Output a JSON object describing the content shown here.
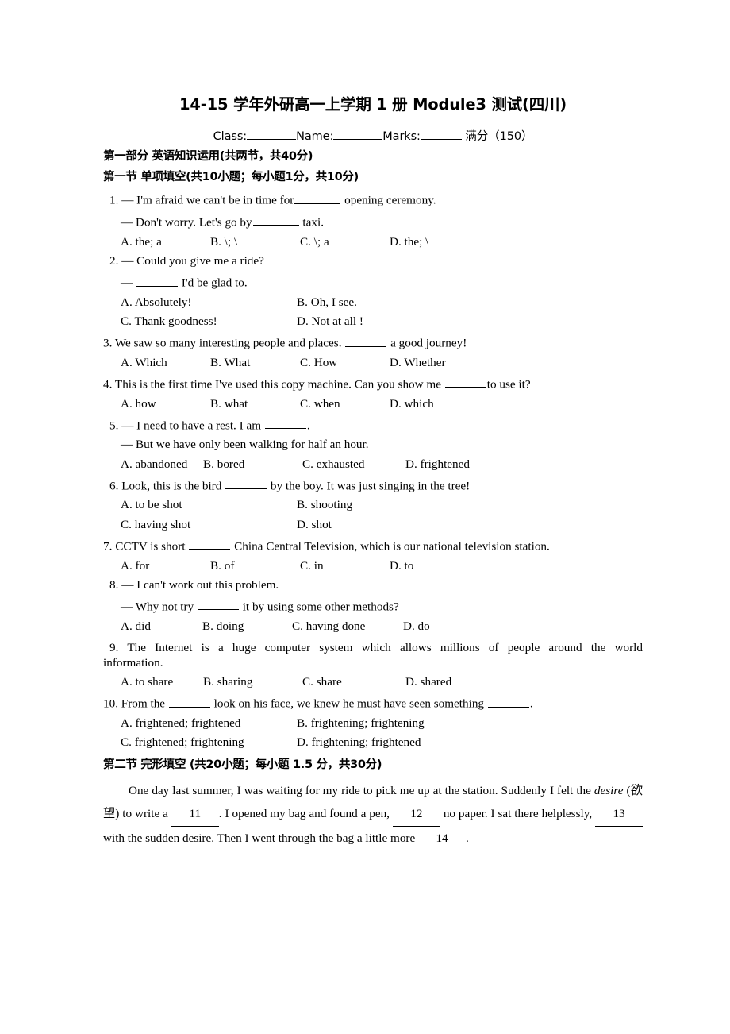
{
  "title": "14-15 学年外研高一上学期 1 册 Module3 测试(四川)",
  "info": {
    "class_label": "Class:",
    "name_label": "Name:",
    "marks_label": "Marks:",
    "total_note": "满分（150）"
  },
  "part1_heading": "第一部分  英语知识运用(共两节，共40分)",
  "section1_heading": "第一节  单项填空(共10小题；每小题1分，共10分)",
  "questions": [
    {
      "number": "1.",
      "stem_a": "— I'm afraid we can't be in time for",
      "stem_b": "opening ceremony.",
      "reply_a": "— Don't worry. Let's go by",
      "reply_b": "taxi.",
      "options": [
        "A. the; a",
        "B. \\; \\",
        "C. \\; a",
        "D. the; \\"
      ]
    },
    {
      "number": "2.",
      "stem_a": "— Could you give me a ride?",
      "reply_a": "—",
      "reply_b": "I'd be glad to.",
      "options": [
        "A. Absolutely!",
        "B. Oh, I see.",
        "C. Thank goodness!",
        "D. Not at all !"
      ]
    },
    {
      "number": "3.",
      "stem_a": "We saw so many interesting people and places.",
      "stem_b": "a good journey!",
      "options": [
        "A. Which",
        "B. What",
        "C. How",
        "D. Whether"
      ]
    },
    {
      "number": "4.",
      "stem_a": "This is the first time I've used this copy machine. Can you show me",
      "stem_b": "to use it?",
      "options": [
        "A. how",
        "B. what",
        "C. when",
        "D. which"
      ]
    },
    {
      "number": "5.",
      "stem_a": "— I need to have a rest. I am",
      "stem_b": ".",
      "reply_a": "— But we have only been walking for half an hour.",
      "options": [
        "A. abandoned",
        "B. bored",
        "C. exhausted",
        "D. frightened"
      ]
    },
    {
      "number": "6.",
      "stem_a": "Look, this is the bird",
      "stem_b": "by the boy. It was just singing in the tree!",
      "options": [
        "A. to be shot",
        "B. shooting",
        "C. having shot",
        "D. shot"
      ]
    },
    {
      "number": "7.",
      "stem_a": "CCTV is short",
      "stem_b": "China Central Television, which is our national television station.",
      "options": [
        "A. for",
        "B. of",
        "C. in",
        "D. to"
      ]
    },
    {
      "number": "8.",
      "stem_a": "— I can't work out this problem.",
      "reply_a": "— Why not try",
      "reply_b": "it by using some other methods?",
      "options": [
        "A. did",
        "B. doing",
        "C. having done",
        "D. do"
      ]
    },
    {
      "number": "9.",
      "stem_a": "The Internet is a huge computer system which allows millions of people around the world",
      "stem_b": "information.",
      "options": [
        "A. to share",
        "B. sharing",
        "C. share",
        "D. shared"
      ]
    },
    {
      "number": "10.",
      "stem_a": "From the",
      "stem_b": "look on his face, we knew he must have seen something",
      "stem_c": ".",
      "options": [
        "A. frightened; frightened",
        "B. frightening; frightening",
        "C. frightened; frightening",
        "D. frightening; frightened"
      ]
    }
  ],
  "section2_heading": "第二节  完形填空  (共20小题；每小题  1.5  分，共30分)",
  "passage": {
    "p1": "One day last summer, I was waiting for my ride to pick me up at the station. Suddenly I felt the",
    "p2_italic": "desire",
    "p2_gloss": "(欲望) to write a",
    "blank_11": "11",
    "p3": ". I opened my bag and found a pen,",
    "blank_12": "12",
    "p4": "no paper. I sat there",
    "p5": "helplessly,",
    "blank_13": "13",
    "p6": "with the sudden desire. Then I went through the bag a little more",
    "blank_14": "14",
    "p7": "."
  }
}
